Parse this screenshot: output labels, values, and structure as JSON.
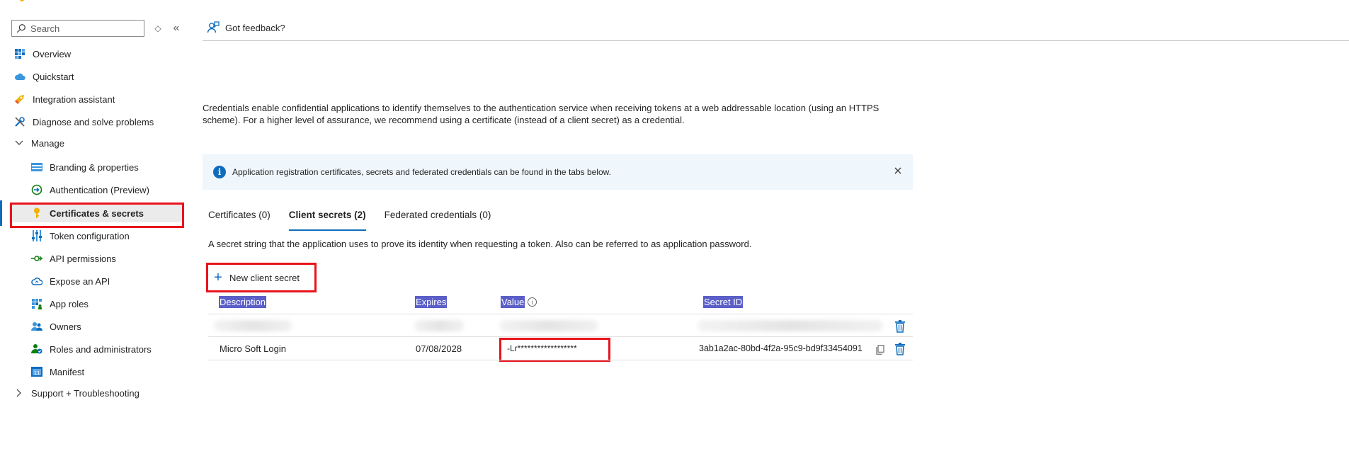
{
  "sidebar": {
    "search_placeholder": "Search",
    "items": [
      {
        "label": "Overview"
      },
      {
        "label": "Quickstart"
      },
      {
        "label": "Integration assistant"
      },
      {
        "label": "Diagnose and solve problems"
      },
      {
        "label": "Manage"
      },
      {
        "label": "Branding & properties"
      },
      {
        "label": "Authentication (Preview)"
      },
      {
        "label": "Certificates & secrets"
      },
      {
        "label": "Token configuration"
      },
      {
        "label": "API permissions"
      },
      {
        "label": "Expose an API"
      },
      {
        "label": "App roles"
      },
      {
        "label": "Owners"
      },
      {
        "label": "Roles and administrators"
      },
      {
        "label": "Manifest"
      },
      {
        "label": "Support + Troubleshooting"
      }
    ]
  },
  "toolbar": {
    "feedback_label": "Got feedback?"
  },
  "main": {
    "description": "Credentials enable confidential applications to identify themselves to the authentication service when receiving tokens at a web addressable location (using an HTTPS scheme). For a higher level of assurance, we recommend using a certificate (instead of a client secret) as a credential.",
    "banner_text": "Application registration certificates, secrets and federated credentials can be found in the tabs below.",
    "tabs": [
      {
        "label": "Certificates (0)"
      },
      {
        "label": "Client secrets (2)"
      },
      {
        "label": "Federated credentials (0)"
      }
    ],
    "tab_description": "A secret string that the application uses to prove its identity when requesting a token. Also can be referred to as application password.",
    "new_button_label": "New client secret",
    "table": {
      "headers": [
        "Description",
        "Expires",
        "Value",
        "Secret ID"
      ],
      "rows": [
        {
          "description": "Micro Soft Login",
          "expires": "07/08/2028",
          "value": "-Lr******************",
          "secret_id": "3ab1a2ac-80bd-4f2a-95c9-bd9f33454091"
        }
      ]
    }
  },
  "colors": {
    "accent": "#0f6cbd",
    "highlight_box": "#e8141c",
    "selected_bg": "#ebebeb",
    "header_highlight": "#5b5fc7"
  }
}
